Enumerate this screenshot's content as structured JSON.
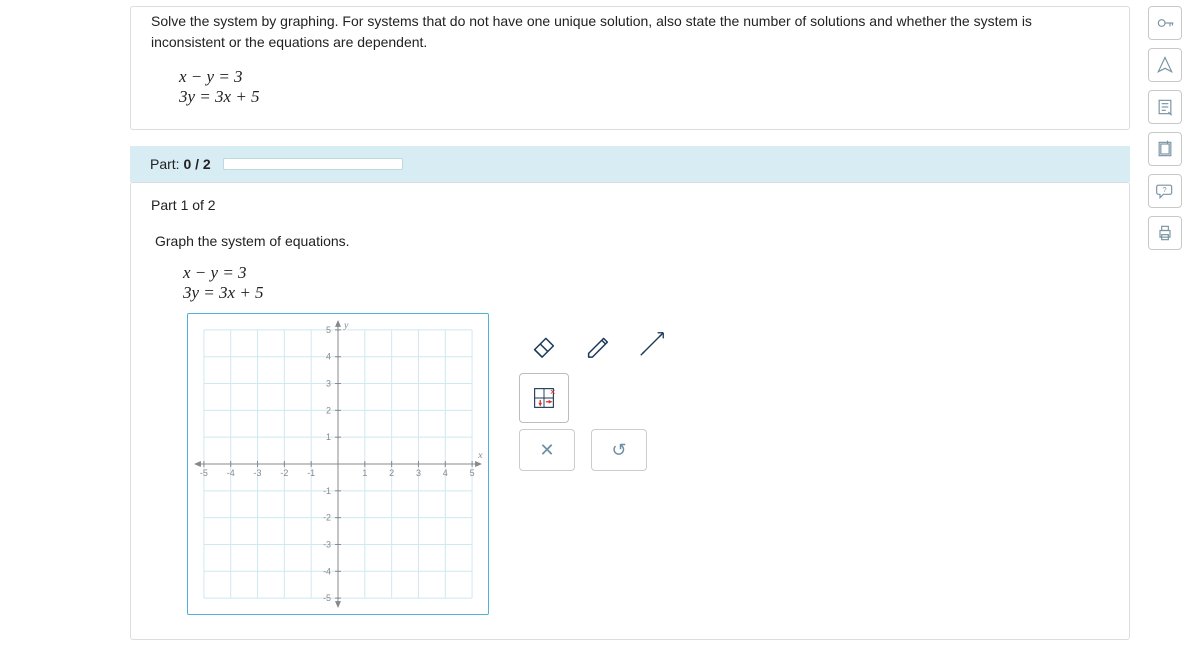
{
  "question": {
    "instructions": "Solve the system by graphing. For systems that do not have one unique solution, also state the number of solutions and whether the system is inconsistent or the equations are dependent.",
    "eq1": "x − y = 3",
    "eq2": "3y = 3x + 5"
  },
  "progress": {
    "label_prefix": "Part: ",
    "label_value": "0 / 2"
  },
  "part1": {
    "header": "Part 1 of 2",
    "instruction": "Graph the system of equations.",
    "eq1": "x − y = 3",
    "eq2": "3y = 3x + 5"
  },
  "tools": {
    "clear_x": "✕",
    "undo": "↺"
  },
  "chart_data": {
    "type": "scatter",
    "title": "",
    "xlabel": "x",
    "ylabel": "y",
    "xlim": [
      -5,
      5
    ],
    "ylim": [
      -5,
      5
    ],
    "x_ticks": [
      -5,
      -4,
      -3,
      -2,
      -1,
      1,
      2,
      3,
      4,
      5
    ],
    "y_ticks": [
      -5,
      -4,
      -3,
      -2,
      -1,
      1,
      2,
      3,
      4,
      5
    ],
    "series": []
  }
}
